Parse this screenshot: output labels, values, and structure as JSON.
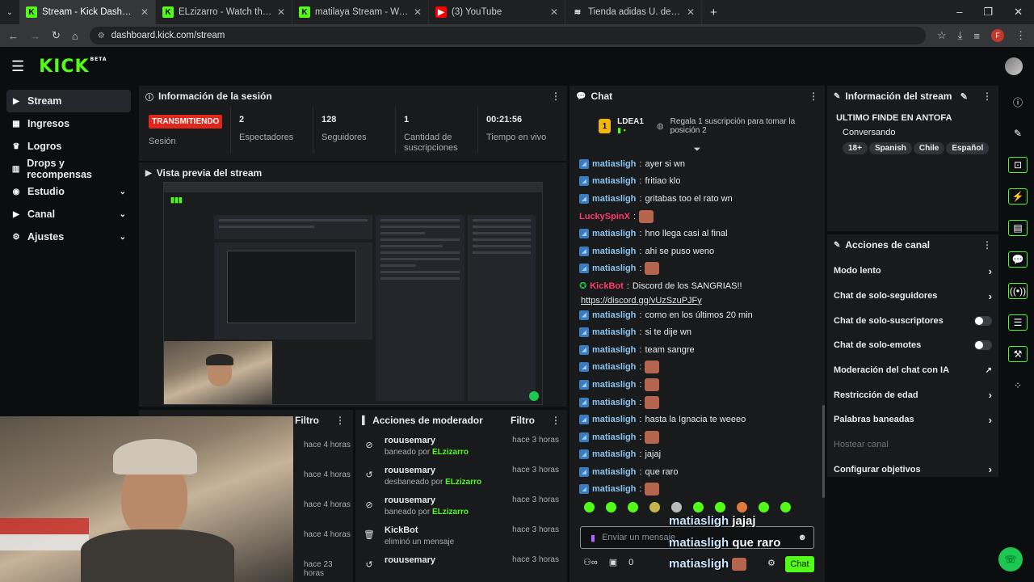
{
  "browser": {
    "tabs": [
      {
        "label": "Stream - Kick Dashboard",
        "icon": "kick-icon",
        "active": true
      },
      {
        "label": "ELzizarro - Watch the VOD on K",
        "icon": "kick-icon"
      },
      {
        "label": "matilaya Stream - Watch Live o",
        "icon": "kick-icon"
      },
      {
        "label": "(3) YouTube",
        "icon": "youtube-icon"
      },
      {
        "label": "Tienda adidas U. de Chile: Cam",
        "icon": "adidas-icon"
      }
    ],
    "url": "dashboard.kick.com/stream",
    "profile_initial": "F"
  },
  "header": {
    "logo": "KICK",
    "logo_sup": "BETA"
  },
  "sidebar": {
    "items": [
      {
        "label": "Stream",
        "icon": "stream-icon",
        "active": true
      },
      {
        "label": "Ingresos",
        "icon": "revenue-icon"
      },
      {
        "label": "Logros",
        "icon": "trophy-icon"
      },
      {
        "label": "Drops y recompensas",
        "icon": "gift-icon"
      },
      {
        "label": "Estudio",
        "icon": "studio-icon",
        "expandable": true
      },
      {
        "label": "Canal",
        "icon": "channel-icon",
        "expandable": true
      },
      {
        "label": "Ajustes",
        "icon": "gear-icon",
        "expandable": true
      }
    ]
  },
  "session": {
    "title": "Información de la sesión",
    "status_badge": "TRANSMITIENDO",
    "status_label": "Sesión",
    "stats": [
      {
        "value": "2",
        "label": "Espectadores"
      },
      {
        "value": "128",
        "label": "Seguidores"
      },
      {
        "value": "1",
        "label": "Cantidad de suscripciones"
      },
      {
        "value": "00:21:56",
        "label": "Tiempo en vivo"
      }
    ]
  },
  "preview": {
    "title": "Vista previa del stream"
  },
  "left_lower": {
    "filter_label": "Filtro",
    "times": [
      "hace 4 horas",
      "hace 4 horas",
      "hace 4 horas",
      "hace 4 horas",
      "hace 23 horas"
    ]
  },
  "mod_actions": {
    "title": "Acciones de moderador",
    "filter_label": "Filtro",
    "rows": [
      {
        "user": "rouusemary",
        "action": "baneado por",
        "by": "ELzizarro",
        "time": "hace 3 horas",
        "icon": "ban-icon"
      },
      {
        "user": "rouusemary",
        "action": "desbaneado por",
        "by": "ELzizarro",
        "time": "hace 3 horas",
        "icon": "undo-icon"
      },
      {
        "user": "rouusemary",
        "action": "baneado por",
        "by": "ELzizarro",
        "time": "hace 3 horas",
        "icon": "ban-icon"
      },
      {
        "user": "KickBot",
        "action": "eliminó un mensaje",
        "by": "",
        "time": "hace 3 horas",
        "icon": "trash-icon"
      },
      {
        "user": "rouusemary",
        "action": "",
        "by": "",
        "time": "hace 3 horas",
        "icon": "undo-icon"
      }
    ]
  },
  "chat": {
    "title": "Chat",
    "top_user": "LDEA1",
    "top_rank": "1",
    "top_sub_prompt": "Regala 1 suscripción para tomar la posición 2",
    "messages": [
      {
        "user": "matiasligh",
        "text": "ayer si wn"
      },
      {
        "user": "matiasligh",
        "text": "fritiao klo"
      },
      {
        "user": "matiasligh",
        "text": "gritabas too el rato wn"
      },
      {
        "user": "LuckySpinX",
        "text": "",
        "emote": true,
        "pink": true
      },
      {
        "user": "matiasligh",
        "text": "hno llega casi al final"
      },
      {
        "user": "matiasligh",
        "text": "ahi se puso weno"
      },
      {
        "user": "matiasligh",
        "text": "",
        "emote": true
      },
      {
        "user": "KickBot",
        "text": "Discord de los SANGRIAS!!",
        "pink": true,
        "bot": true
      },
      {
        "user": "",
        "text": "https://discord.gg/vUzSzuPJFy",
        "link": true
      },
      {
        "user": "matiasligh",
        "text": "como en los últimos 20 min"
      },
      {
        "user": "matiasligh",
        "text": "si te dije wn"
      },
      {
        "user": "matiasligh",
        "text": "team sangre"
      },
      {
        "user": "matiasligh",
        "text": "",
        "emote": true
      },
      {
        "user": "matiasligh",
        "text": "",
        "emote": true
      },
      {
        "user": "matiasligh",
        "text": "",
        "emote": true
      },
      {
        "user": "matiasligh",
        "text": "hasta la Ignacia te weeeo"
      },
      {
        "user": "matiasligh",
        "text": "",
        "emote": true
      },
      {
        "user": "matiasligh",
        "text": "jajaj"
      },
      {
        "user": "matiasligh",
        "text": "que raro"
      },
      {
        "user": "matiasligh",
        "text": "",
        "emote": true
      }
    ],
    "input_placeholder": "Enviar un mensaje",
    "points": "0",
    "send_label": "Chat",
    "overlay": [
      {
        "user": "matiasligh",
        "text": "jajaj"
      },
      {
        "user": "matiasligh",
        "text": "que raro"
      },
      {
        "user": "matiasligh",
        "text": ""
      }
    ]
  },
  "stream_info": {
    "title": "Información del stream",
    "stream_title": "ULTIMO FINDE EN ANTOFA",
    "category": "Conversando",
    "tags": [
      "18+",
      "Spanish",
      "Chile",
      "Español"
    ]
  },
  "channel_actions": {
    "title": "Acciones de canal",
    "rows": [
      {
        "label": "Modo lento",
        "control": "arrow"
      },
      {
        "label": "Chat de solo-seguidores",
        "control": "arrow"
      },
      {
        "label": "Chat de solo-suscriptores",
        "control": "toggle"
      },
      {
        "label": "Chat de solo-emotes",
        "control": "toggle"
      },
      {
        "label": "Moderación del chat con IA",
        "control": "external"
      },
      {
        "label": "Restricción de edad",
        "control": "arrow"
      },
      {
        "label": "Palabras baneadas",
        "control": "arrow"
      },
      {
        "label": "Hostear canal",
        "control": "none",
        "disabled": true
      },
      {
        "label": "Configurar objetivos",
        "control": "arrow"
      }
    ]
  },
  "colors": {
    "accent": "#53fc18",
    "live": "#e1261c",
    "panel": "#181a1b",
    "bg": "#0b0e0f"
  }
}
